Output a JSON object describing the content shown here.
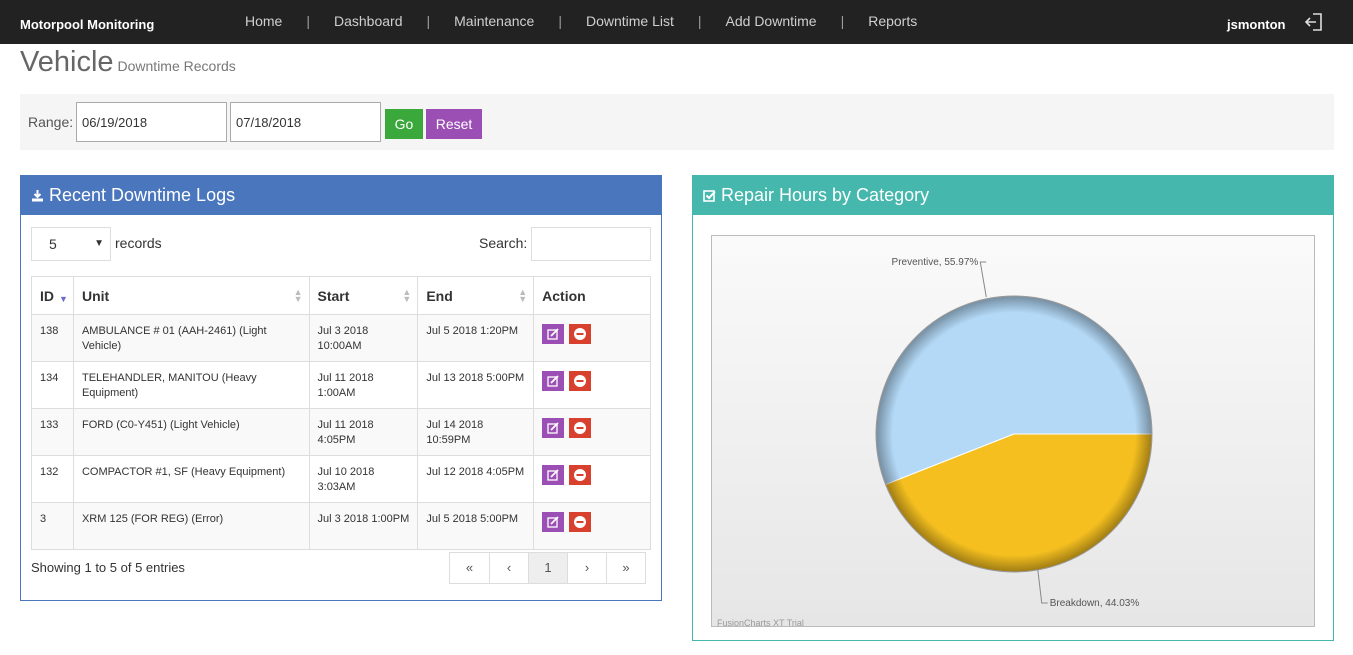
{
  "nav": {
    "brand": "Motorpool Monitoring",
    "items": [
      "Home",
      "Dashboard",
      "Maintenance",
      "Downtime List",
      "Add Downtime",
      "Reports"
    ],
    "separator": "|",
    "user": "jsmonton",
    "logout_icon": "logout-icon"
  },
  "header": {
    "title": "Vehicle",
    "subtitle": "Downtime Records"
  },
  "range": {
    "label": "Range:",
    "from": "06/19/2018",
    "to": "07/18/2018",
    "go_label": "Go",
    "reset_label": "Reset"
  },
  "logs": {
    "title": "Recent Downtime Logs",
    "icon": "download-icon",
    "length_value": "5",
    "length_label": "records",
    "search_label": "Search:",
    "columns": [
      "ID",
      "Unit",
      "Start",
      "End",
      "Action"
    ],
    "rows": [
      {
        "id": "138",
        "unit": "AMBULANCE # 01 (AAH-2461) (Light Vehicle)",
        "start": "Jul 3 2018 10:00AM",
        "end": "Jul 5 2018 1:20PM"
      },
      {
        "id": "134",
        "unit": "TELEHANDLER, MANITOU (Heavy Equipment)",
        "start": "Jul 11 2018 1:00AM",
        "end": "Jul 13 2018 5:00PM"
      },
      {
        "id": "133",
        "unit": "FORD (C0-Y451) (Light Vehicle)",
        "start": "Jul 11 2018 4:05PM",
        "end": "Jul 14 2018 10:59PM"
      },
      {
        "id": "132",
        "unit": "COMPACTOR #1, SF (Heavy Equipment)",
        "start": "Jul 10 2018 3:03AM",
        "end": "Jul 12 2018 4:05PM"
      },
      {
        "id": "3",
        "unit": "XRM 125 (FOR REG) (Error)",
        "start": "Jul 3 2018 1:00PM",
        "end": "Jul 5 2018 5:00PM"
      }
    ],
    "info": "Showing 1 to 5 of 5 entries",
    "pager": [
      "«",
      "‹",
      "1",
      "›",
      "»"
    ],
    "current_page": "1",
    "colors": {
      "header": "#4a76bd",
      "edit": "#9b4fb5",
      "delete": "#d9412f"
    }
  },
  "repair": {
    "title": "Repair Hours by Category",
    "icon": "checkbox-icon",
    "watermark": "FusionCharts XT Trial",
    "colors": {
      "header": "#45b7ad"
    }
  },
  "chart_data": {
    "type": "pie",
    "slices": [
      {
        "label": "Preventive",
        "value": 55.97,
        "color": "#b3d9f7"
      },
      {
        "label": "Breakdown",
        "value": 44.03,
        "color": "#f4bf1f"
      }
    ],
    "slice_labels": [
      "Preventive, 55.97%",
      "Breakdown, 44.03%"
    ]
  }
}
